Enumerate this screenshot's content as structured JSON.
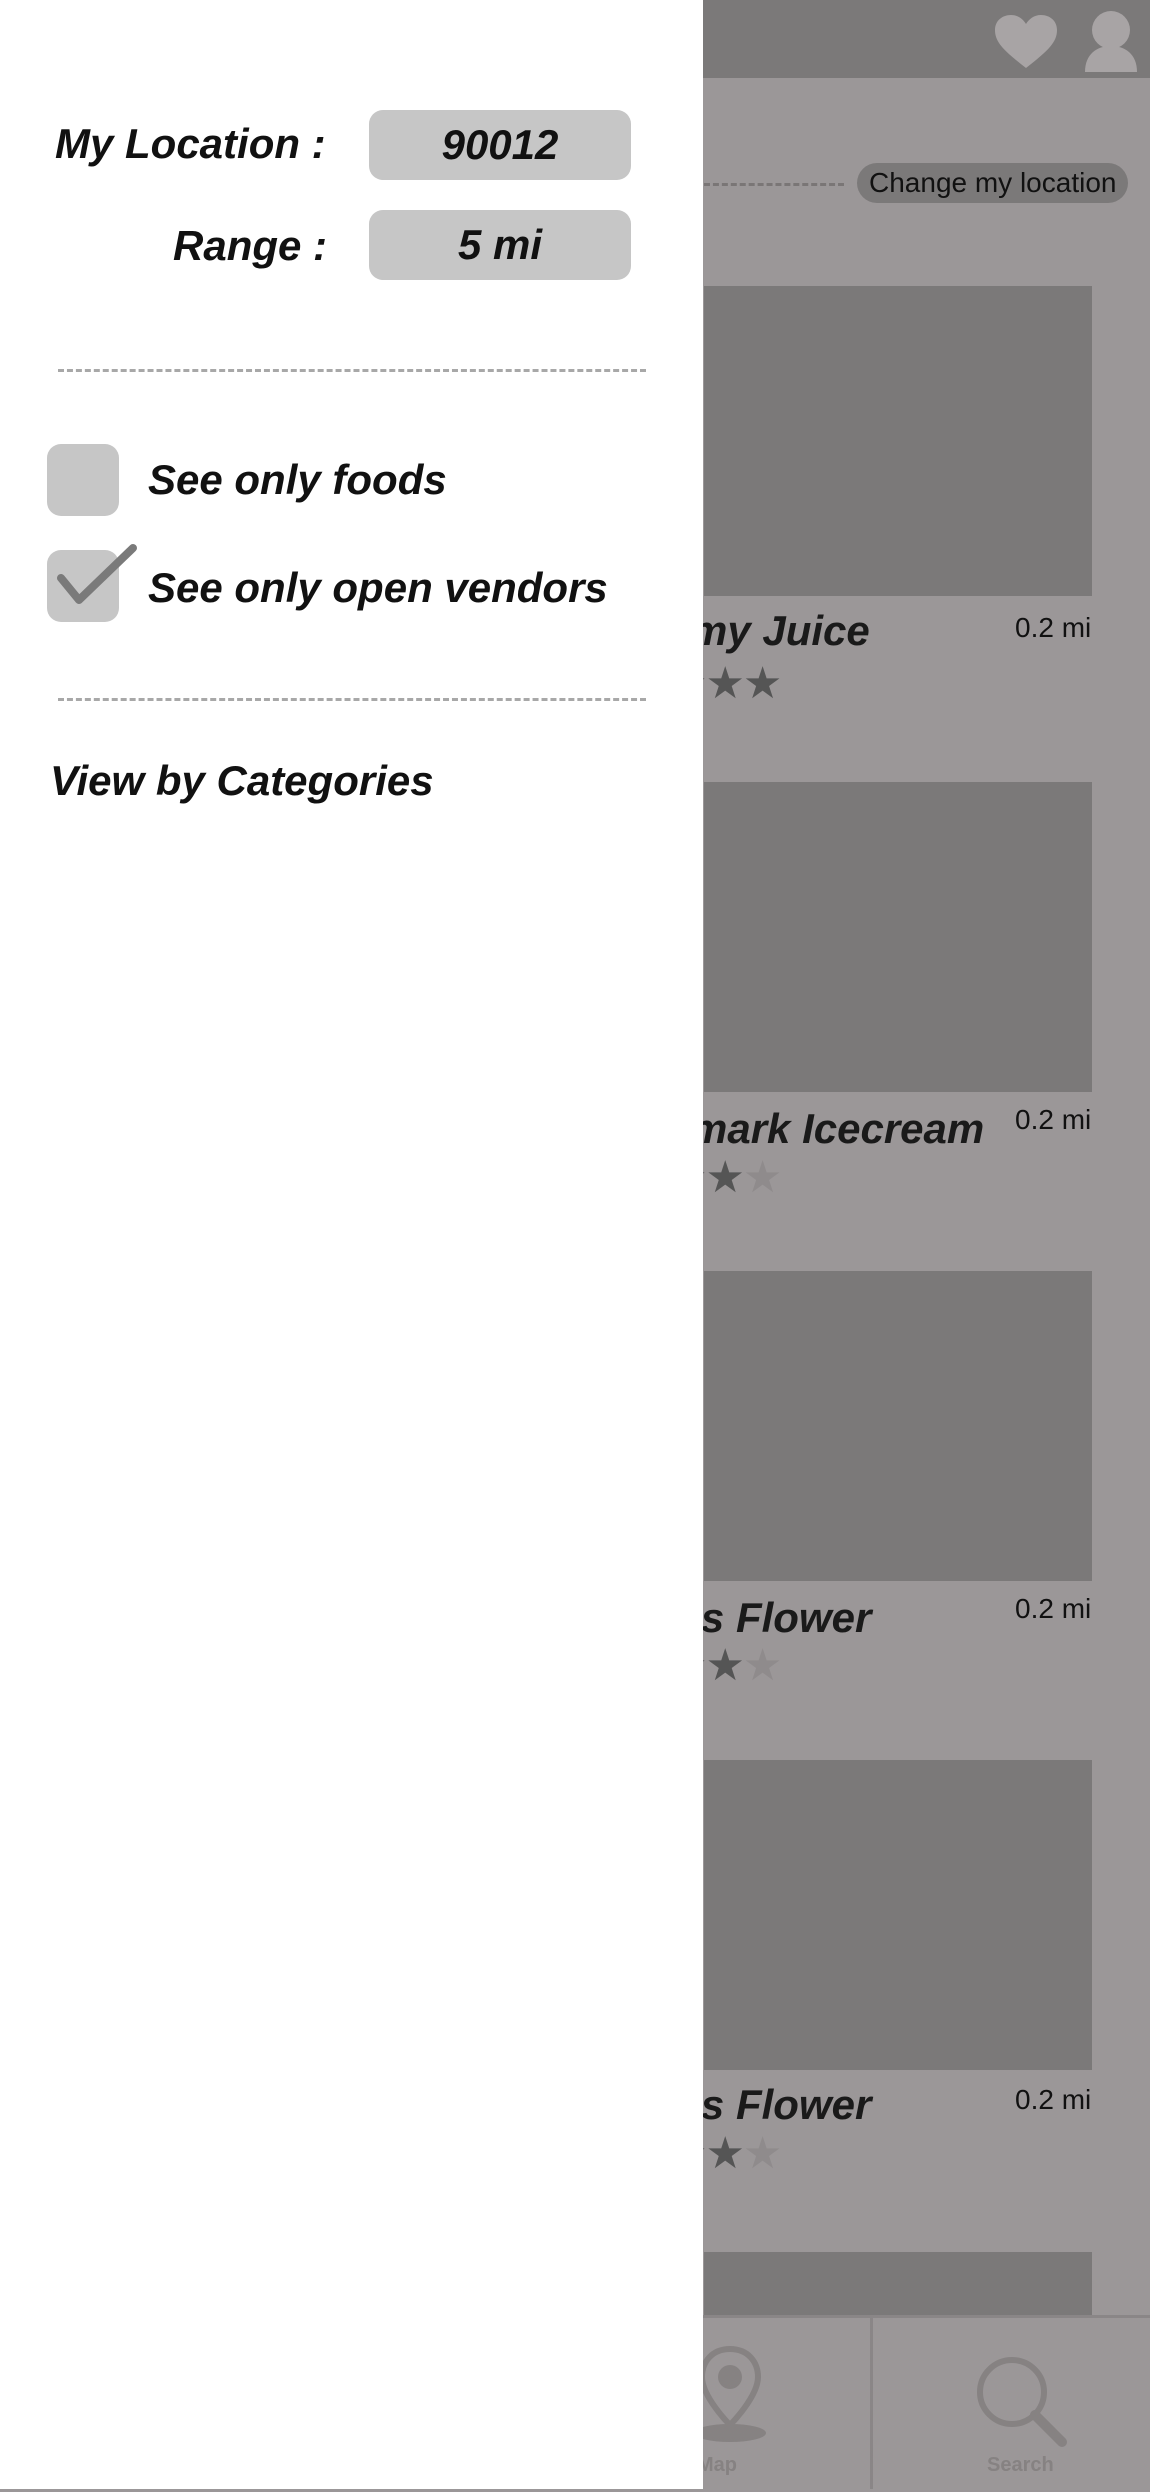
{
  "background": {
    "header": {
      "favorites_icon": "heart-icon",
      "profile_icon": "user-icon"
    },
    "change_location_label": "Change my location",
    "vendors": [
      {
        "title": "my Juice",
        "distance": "0.2 mi",
        "rating": 5
      },
      {
        "title": "mark Icecream",
        "distance": "0.2 mi",
        "rating": 4
      },
      {
        "title": "’s Flower",
        "distance": "0.2 mi",
        "rating": 4
      },
      {
        "title": "’s Flower",
        "distance": "0.2 mi",
        "rating": 4
      }
    ],
    "bottom_nav": {
      "map_label": "Map",
      "map_icon": "map-pin-icon",
      "search_label": "Search",
      "search_icon": "search-icon"
    }
  },
  "drawer": {
    "location_label": "My Location :",
    "location_value": "90012",
    "range_label": "Range :",
    "range_value": "5 mi",
    "filters": [
      {
        "label": "See only foods",
        "checked": false
      },
      {
        "label": "See only open vendors",
        "checked": true
      }
    ],
    "categories_title": "View by Categories"
  },
  "colors": {
    "drawer_bg": "#ffffff",
    "pill_bg": "#c6c6c6",
    "overlay_bg": "#9b9798",
    "card_bg": "#7b7979"
  }
}
